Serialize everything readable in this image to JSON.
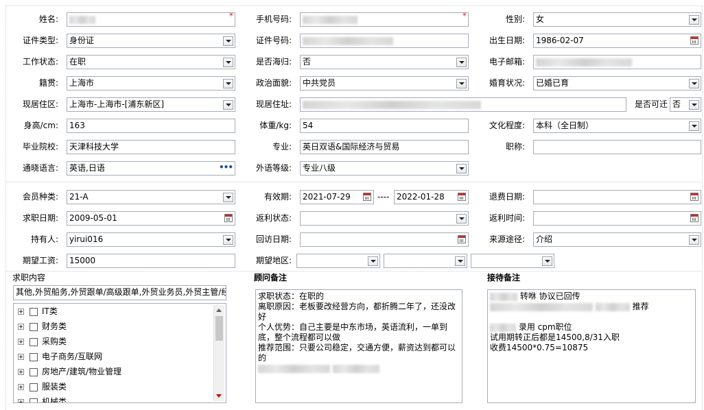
{
  "colors": {
    "border": "#a5acb5",
    "required": "#e02020",
    "ellipsis": "#1f4f9f"
  },
  "row1": {
    "name_label": "姓名:",
    "phone_label": "手机号码:",
    "gender_label": "性别:",
    "gender_value": "女",
    "required_mark": "*"
  },
  "row2": {
    "idtype_label": "证件类型:",
    "idtype_value": "身份证",
    "idnum_label": "证件号码:",
    "birth_label": "出生日期:",
    "birth_value": "1986-02-07"
  },
  "row3": {
    "work_label": "工作状态:",
    "work_value": "在职",
    "returnee_label": "是否海归:",
    "returnee_value": "否",
    "email_label": "电子邮箱:"
  },
  "row4": {
    "native_label": "籍贯:",
    "native_value": "上海市",
    "political_label": "政治面貌:",
    "political_value": "中共党员",
    "marital_label": "婚育状况:",
    "marital_value": "已婚已育"
  },
  "row5": {
    "residence_label": "现居住区:",
    "residence_value": "上海市-上海市-[浦东新区]",
    "address_label": "现居住址:",
    "relocate_label": "是否可迁",
    "relocate_value": "否"
  },
  "row6": {
    "height_label": "身高/cm:",
    "height_value": "163",
    "weight_label": "体重/kg:",
    "weight_value": "54",
    "edu_label": "文化程度:",
    "edu_value": "本科（全日制）"
  },
  "row7": {
    "school_label": "毕业院校:",
    "school_value": "天津科技大学",
    "major_label": "专业:",
    "major_value": "英日双语&国际经济与贸易",
    "title_label": "职称:"
  },
  "row8": {
    "lang_label": "通晓语言:",
    "lang_value": "英语,日语",
    "lang_more": "•••",
    "level_label": "外语等级:",
    "level_value": "专业八级"
  },
  "membership": {
    "type_label": "会员种类:",
    "type_value": "21-A",
    "valid_label": "有效期:",
    "valid_from": "2021-07-29",
    "valid_sep": "----",
    "valid_to": "2022-01-28",
    "refund_label": "退费日期:",
    "jobdate_label": "求职日期:",
    "jobdate_value": "2009-05-01",
    "rebate_status_label": "返利状态:",
    "rebate_time_label": "返利时间:",
    "holder_label": "持有人:",
    "holder_value": "yirui016",
    "visit_label": "回访日期:",
    "source_label": "来源途径:",
    "source_value": "介绍",
    "salary_label": "期望工资:",
    "salary_value": "15000",
    "region_label": "期望地区:"
  },
  "job_content": {
    "title": "求职内容",
    "selected": "其他,外贸船务,外贸跟单/高级跟单,外贸业务员,外贸主管/经",
    "categories": [
      "IT类",
      "财务类",
      "采购类",
      "电子商务/互联网",
      "房地产/建筑/物业管理",
      "服装类",
      "机械类"
    ]
  },
  "consultant_notes": {
    "title": "顾问备注",
    "lines": [
      "求职状态：在职的",
      "离职原因：老板要改经营方向，都折腾二年了，还没改",
      "好",
      "个人优势：自己主要是中东市场，英语流利，一单到",
      "底，整个流程都可以做",
      "推荐范围：只要公司稳定，交通方便，薪资达到都可以",
      "的"
    ]
  },
  "reception_notes": {
    "title": "接待备注",
    "line1": "转咻 协议已回传",
    "line2": "推荐",
    "line3": "录用  cpm职位",
    "line4": "试用期转正后都是14500,8/31入职",
    "line5": "收费14500*0.75=10875"
  }
}
